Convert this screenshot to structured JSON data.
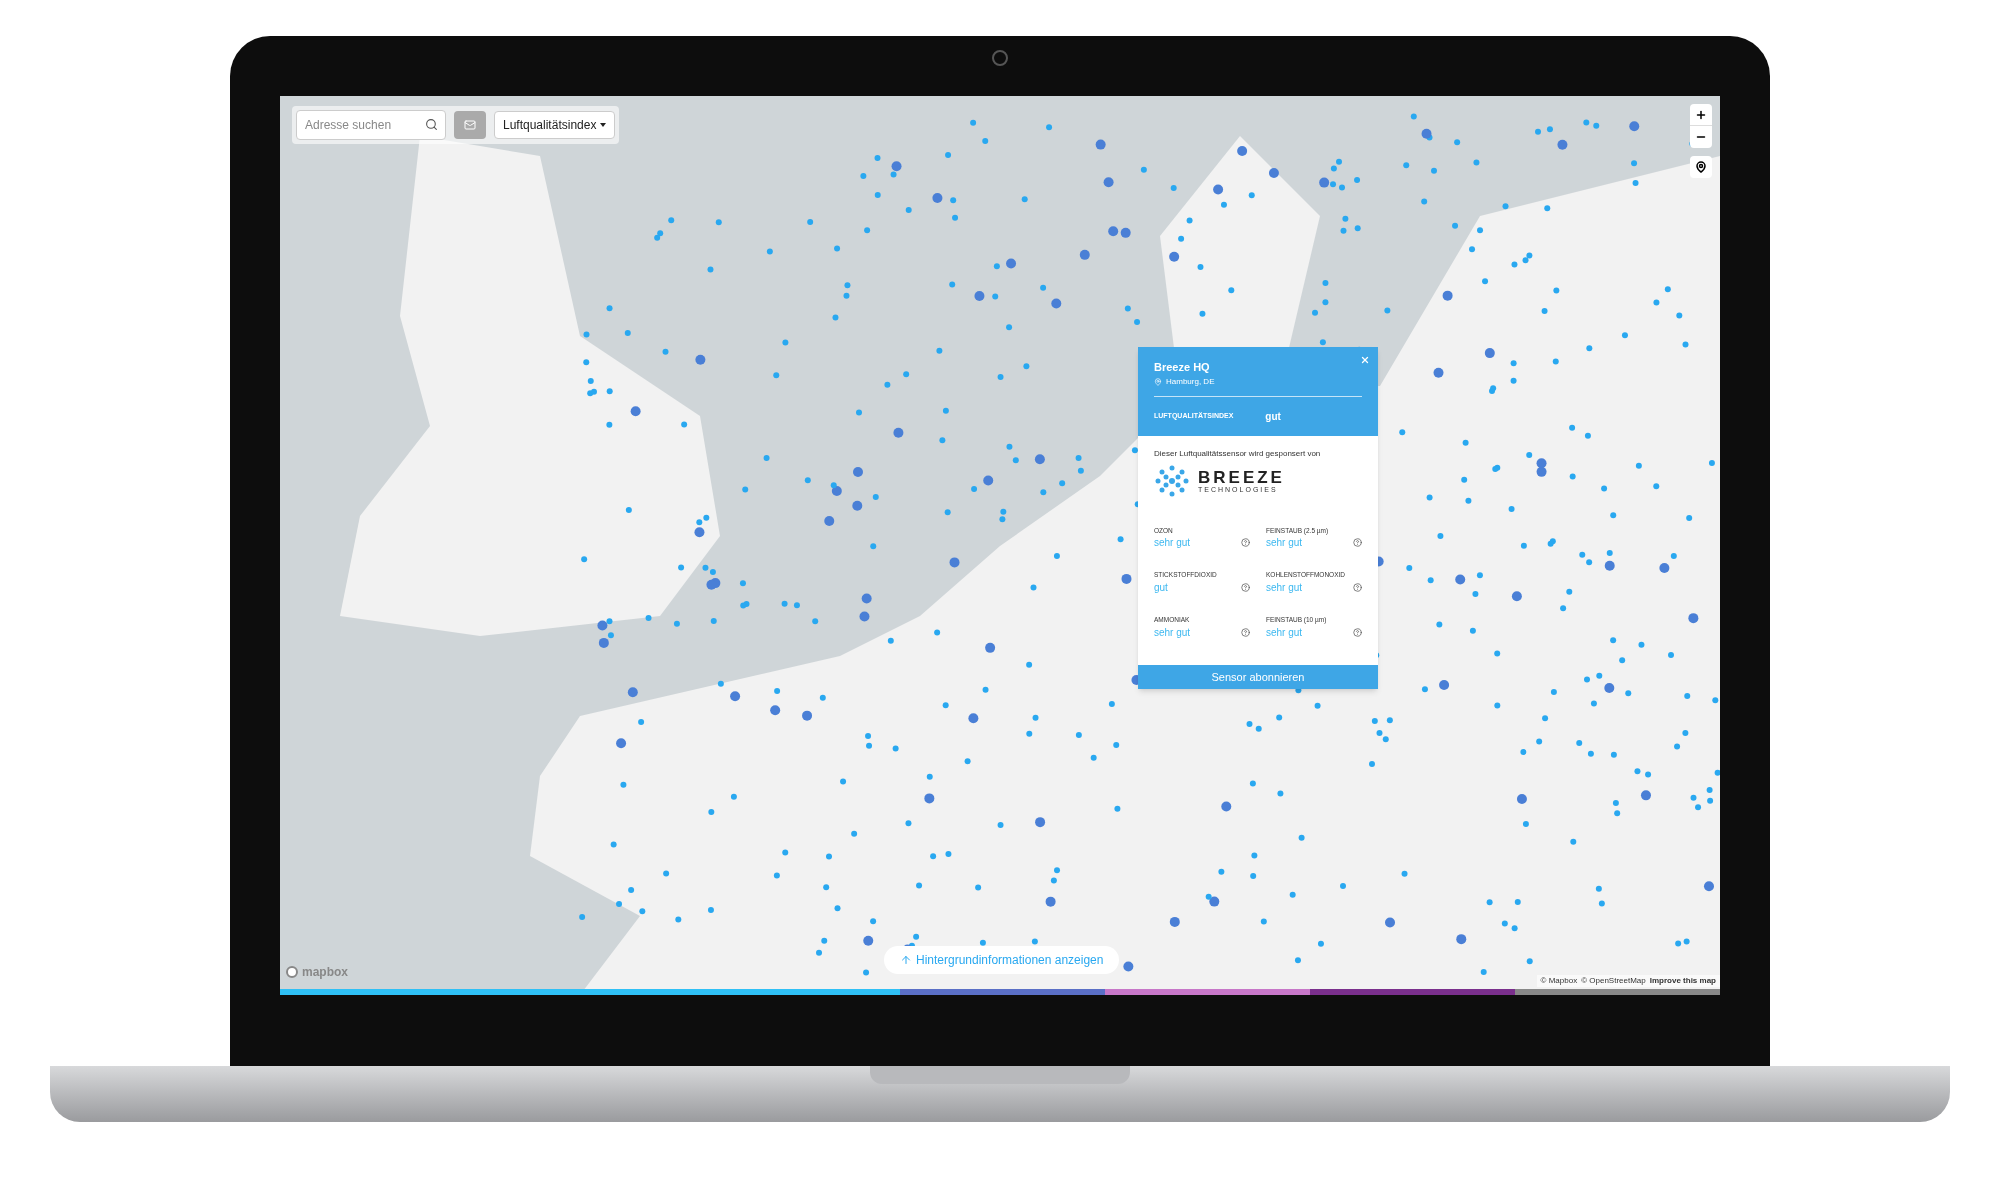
{
  "toolbar": {
    "search": {
      "placeholder": "Adresse suchen"
    },
    "layer_select": {
      "value": "Luftqualitätsindex"
    }
  },
  "popup": {
    "title": "Breeze HQ",
    "location": "Hamburg, DE",
    "index_label": "LUFTQUALITÄTSINDEX",
    "index_value": "gut",
    "sponsor_text": "Dieser Luftqualitätssensor wird gesponsert von",
    "sponsor_logo": {
      "name": "BREEZE",
      "tagline": "TECHNOLOGIES"
    },
    "measurements": [
      {
        "label": "OZON",
        "value": "sehr gut"
      },
      {
        "label": "FEINSTAUB (2.5 µm)",
        "value": "sehr gut"
      },
      {
        "label": "STICKSTOFFDIOXID",
        "value": "gut"
      },
      {
        "label": "KOHLENSTOFFMONOXID",
        "value": "sehr gut"
      },
      {
        "label": "AMMONIAK",
        "value": "sehr gut"
      },
      {
        "label": "FEINSTAUB (10 µm)",
        "value": "sehr gut"
      }
    ],
    "subscribe_button": "Sensor abonnieren"
  },
  "background_info_button": "Hintergrundinformationen anzeigen",
  "mapbox_logo": "mapbox",
  "attribution": [
    "© Mapbox",
    "© OpenStreetMap",
    "Improve this map"
  ]
}
